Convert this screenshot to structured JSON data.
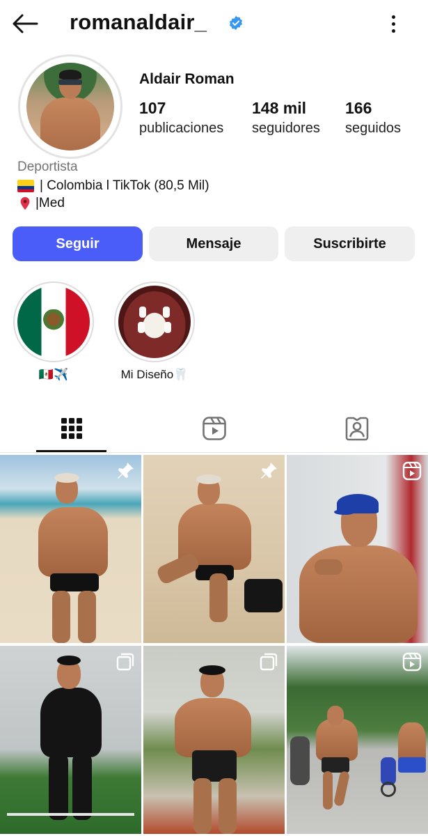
{
  "header": {
    "username": "romanaldair_",
    "verified": true,
    "back_icon": "arrow-left-icon",
    "menu_icon": "more-vertical-icon"
  },
  "profile": {
    "display_name": "Aldair Roman",
    "stats": [
      {
        "value": "107",
        "label": "publicaciones"
      },
      {
        "value": "148 mil",
        "label": "seguidores"
      },
      {
        "value": "166",
        "label": "seguidos"
      }
    ],
    "category": "Deportista",
    "bio_line1": "| Colombia l TikTok (80,5 Mil)",
    "bio_line2": "|Med"
  },
  "actions": {
    "follow_label": "Seguir",
    "message_label": "Mensaje",
    "subscribe_label": "Suscribirte"
  },
  "highlights": [
    {
      "label": "🇲🇽✈️",
      "icon": "mexico-flag"
    },
    {
      "label": "Mi Diseño🦷",
      "icon": "teeth-photo"
    }
  ],
  "tabs": [
    {
      "name": "posts",
      "icon": "grid-icon",
      "active": true
    },
    {
      "name": "reels",
      "icon": "reels-icon",
      "active": false
    },
    {
      "name": "tagged",
      "icon": "tagged-person-icon",
      "active": false
    }
  ],
  "posts": [
    {
      "badge": "pin-icon"
    },
    {
      "badge": "pin-icon"
    },
    {
      "badge": "reel-icon"
    },
    {
      "badge": "carousel-icon"
    },
    {
      "badge": "carousel-icon"
    },
    {
      "badge": "reel-icon"
    }
  ],
  "colors": {
    "accent": "#4a5df9",
    "verified": "#3897f0",
    "secondary_button": "#efefef",
    "muted_text": "#737373"
  }
}
